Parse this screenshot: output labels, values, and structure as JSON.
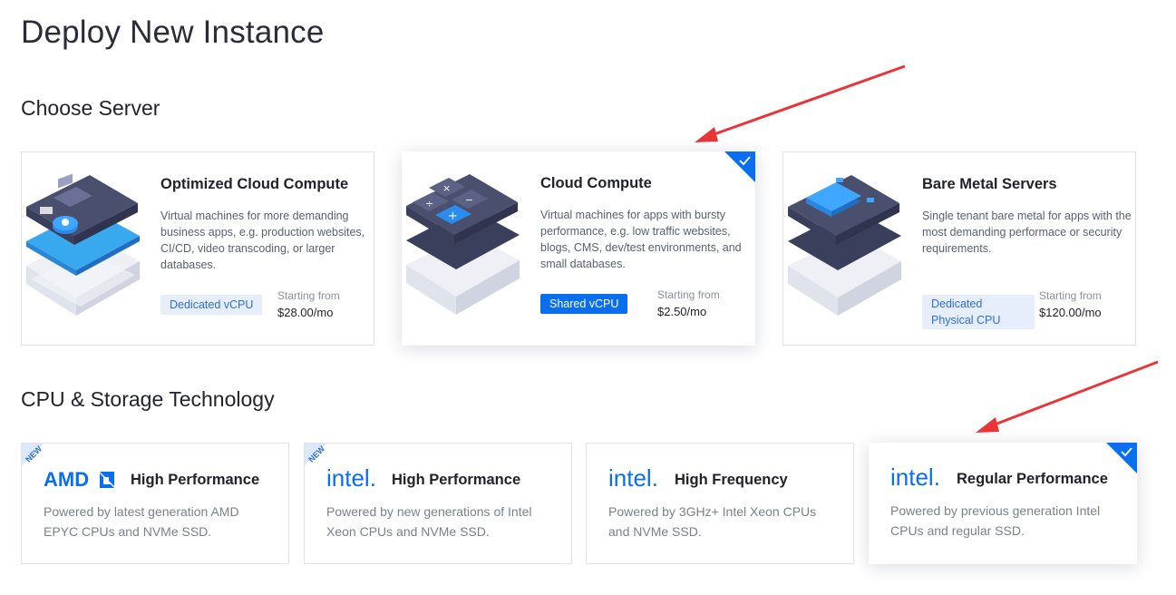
{
  "page": {
    "title": "Deploy New Instance"
  },
  "sections": {
    "server": "Choose Server",
    "tech": "CPU & Storage Technology"
  },
  "servers": [
    {
      "name": "Optimized Cloud Compute",
      "description": "Virtual machines for more demanding business apps, e.g. production websites, CI/CD, video transcoding, or larger databases.",
      "badge": "Dedicated vCPU",
      "price_label": "Starting from",
      "price": "$28.00/mo",
      "selected": false
    },
    {
      "name": "Cloud Compute",
      "description": "Virtual machines for apps with bursty performance, e.g. low traffic websites, blogs, CMS, dev/test environments, and small databases.",
      "badge": "Shared vCPU",
      "price_label": "Starting from",
      "price": "$2.50/mo",
      "selected": true
    },
    {
      "name": "Bare Metal Servers",
      "description": "Single tenant bare metal for apps with the most demanding performace or security requirements.",
      "badge": "Dedicated Physical CPU",
      "price_label": "Starting from",
      "price": "$120.00/mo",
      "selected": false
    }
  ],
  "tech": [
    {
      "logo": "AMD",
      "name": "High Performance",
      "description": "Powered by latest generation AMD EPYC CPUs and NVMe SSD.",
      "ribbon": "NEW",
      "selected": false
    },
    {
      "logo": "intel.",
      "name": "High Performance",
      "description": "Powered by new generations of Intel Xeon CPUs and NVMe SSD.",
      "ribbon": "NEW",
      "selected": false
    },
    {
      "logo": "intel.",
      "name": "High Frequency",
      "description": "Powered by 3GHz+ Intel Xeon CPUs and NVMe SSD.",
      "ribbon": "",
      "selected": false
    },
    {
      "logo": "intel.",
      "name": "Regular Performance",
      "description": "Powered by previous generation Intel CPUs and regular SSD.",
      "ribbon": "",
      "selected": true
    }
  ],
  "colors": {
    "accent": "#0a6ef0",
    "badge_bg": "#e6eefb",
    "annotation_arrow": "#e8353a"
  },
  "icons": [
    "check-icon",
    "server-optimized-illustration",
    "server-cloud-illustration",
    "server-baremetal-illustration",
    "amd-logo",
    "intel-logo",
    "annotation-arrow"
  ]
}
